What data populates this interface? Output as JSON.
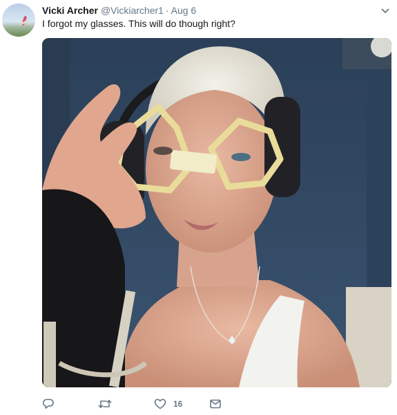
{
  "tweet": {
    "author_name": "Vicki Archer",
    "handle": "@Vickiarcher1",
    "separator": "·",
    "date": "Aug 6",
    "text": "I forgot my glasses. This will do though right?",
    "avatar": "profile-photo",
    "media": "photo-woman-paper-glasses-headphones"
  },
  "actions": {
    "reply_icon": "reply-icon",
    "retweet_icon": "retweet-icon",
    "like_icon": "heart-icon",
    "like_count": "16",
    "dm_icon": "envelope-icon"
  },
  "menu": {
    "icon": "chevron-down-icon"
  },
  "colors": {
    "text": "#14171a",
    "muted": "#657786",
    "background": "#ffffff"
  }
}
